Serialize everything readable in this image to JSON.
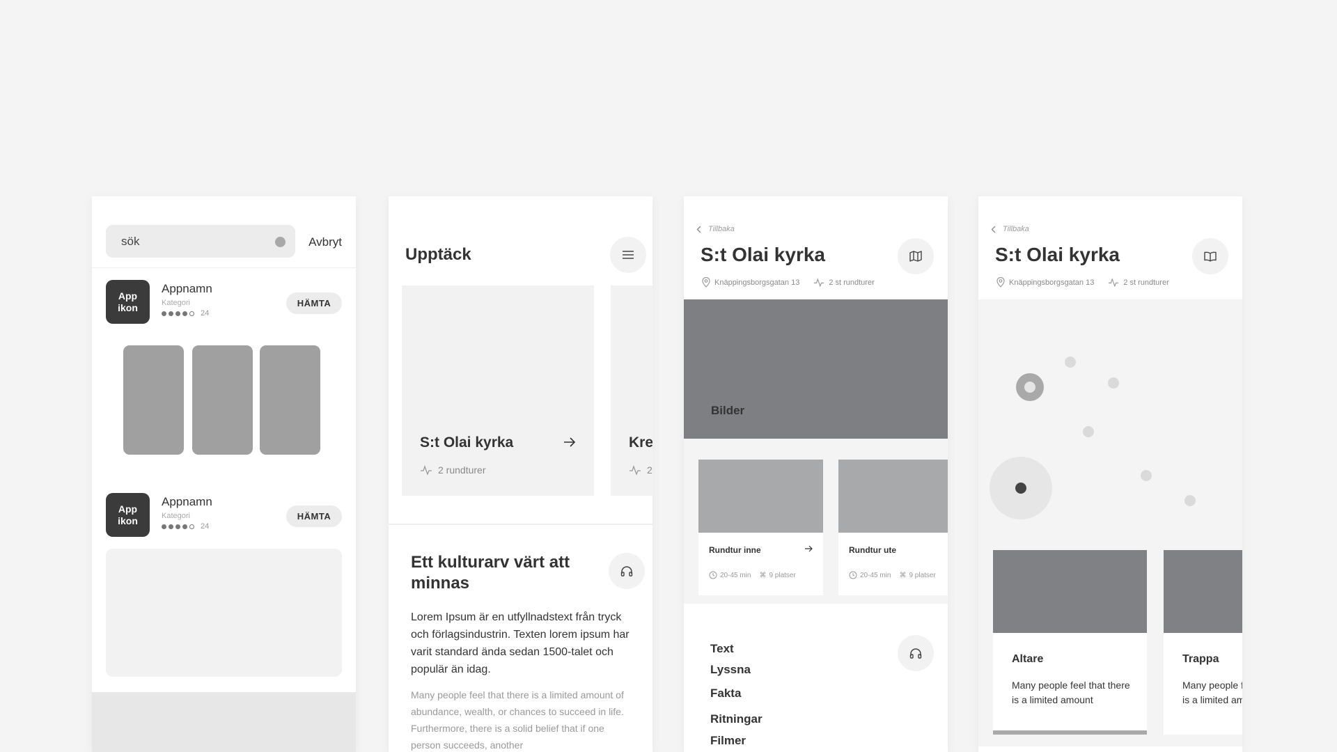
{
  "search_screen": {
    "query": "sök",
    "cancel_label": "Avbryt",
    "apps": [
      {
        "icon_text": "App\nikon",
        "name": "Appnamn",
        "category": "Kategori",
        "rating_filled": 4,
        "rating_total": 5,
        "rating_count": "24",
        "get_label": "HÄMTA"
      },
      {
        "icon_text": "App\nikon",
        "name": "Appnamn",
        "category": "Kategori",
        "rating_filled": 4,
        "rating_total": 5,
        "rating_count": "24",
        "get_label": "HÄMTA"
      }
    ]
  },
  "discover_screen": {
    "title": "Upptäck",
    "menu_icon": "hamburger-icon",
    "cards": [
      {
        "title": "S:t Olai kyrka",
        "subtitle": "2 rundturer"
      },
      {
        "title": "Kre",
        "subtitle": "2"
      }
    ],
    "section_heading": "Ett kulturarv värt att minnas",
    "lead_text": "Lorem Ipsum är en utfyllnadstext från tryck och förlagsindustrin. Texten lorem ipsum har varit standard ända sedan 1500-talet och populär än idag.",
    "body_text": "Many people feel that there is a limited amount of abundance, wealth, or chances to succeed in life. Furthermore, there is a solid belief that if one person succeeds, another"
  },
  "detail_screen": {
    "back_label": "Tillbaka",
    "title": "S:t Olai kyrka",
    "address": "Knäppingsborgsgatan 13",
    "tours_count": "2 st rundturer",
    "hero_label": "Bilder",
    "tours": [
      {
        "name": "Rundtur inne",
        "duration": "20-45 min",
        "places": "9 platser"
      },
      {
        "name": "Rundtur ute",
        "duration": "20-45 min",
        "places": "9 platser"
      }
    ],
    "menu": [
      "Text",
      "Lyssna",
      "Fakta",
      "Ritningar",
      "Filmer"
    ]
  },
  "map_screen": {
    "back_label": "Tillbaka",
    "title": "S:t Olai kyrka",
    "address": "Knäppingsborgsgatan 13",
    "tours_count": "2 st rundturer",
    "stops": [
      {
        "name": "Altare",
        "description": "Many people feel that there is a limited amount"
      },
      {
        "name": "Trappa",
        "description": "Many people feel that there is a limited amount"
      }
    ]
  }
}
